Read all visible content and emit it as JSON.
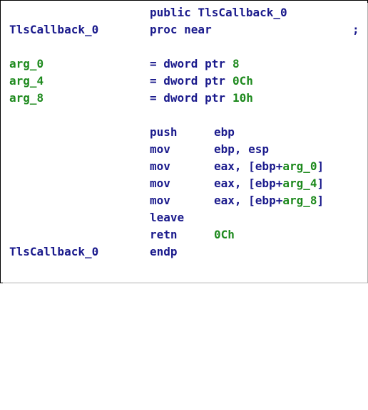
{
  "listing": {
    "header_public": "public TlsCallback_0",
    "proc": {
      "label": "TlsCallback_0",
      "directive": "proc near",
      "comment_marker": ";"
    },
    "args": [
      {
        "name": "arg_0",
        "eq": "= dword ptr",
        "value": "8"
      },
      {
        "name": "arg_4",
        "eq": "= dword ptr",
        "value": "0Ch"
      },
      {
        "name": "arg_8",
        "eq": "= dword ptr",
        "value": "10h"
      }
    ],
    "instructions": [
      {
        "mnemonic": "push",
        "op_plain": "ebp"
      },
      {
        "mnemonic": "mov",
        "op_plain": "ebp, esp"
      },
      {
        "mnemonic": "mov",
        "op_prefix": "eax, [ebp+",
        "op_ref": "arg_0",
        "op_suffix": "]"
      },
      {
        "mnemonic": "mov",
        "op_prefix": "eax, [ebp+",
        "op_ref": "arg_4",
        "op_suffix": "]"
      },
      {
        "mnemonic": "mov",
        "op_prefix": "eax, [ebp+",
        "op_ref": "arg_8",
        "op_suffix": "]"
      },
      {
        "mnemonic": "leave"
      },
      {
        "mnemonic": "retn",
        "op_num": "0Ch"
      }
    ],
    "endp": {
      "label": "TlsCallback_0",
      "directive": "endp"
    }
  },
  "colors": {
    "keyword": "#1a1a8c",
    "label_green": "#1e8a1e",
    "border": "#000000"
  }
}
